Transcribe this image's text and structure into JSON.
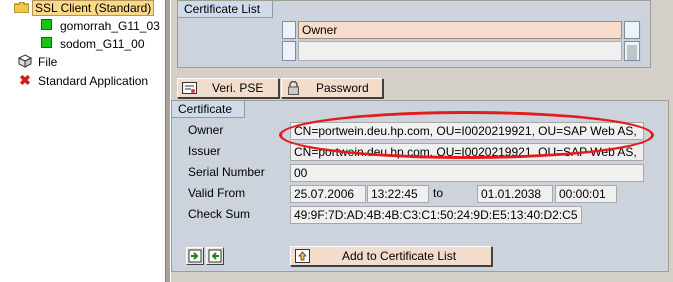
{
  "tree": {
    "root_label": "SSL Client (Standard)",
    "children": [
      "gomorrah_G11_03",
      "sodom_G11_00"
    ],
    "file_label": "File",
    "standard_app_label": "Standard Application"
  },
  "cert_list": {
    "title": "Certificate List",
    "column_header": "Owner",
    "rows": [
      ""
    ]
  },
  "buttons": {
    "veri_pse": "Veri. PSE",
    "password": "Password",
    "add_to_list": "Add to Certificate List"
  },
  "certificate": {
    "title": "Certificate",
    "owner_label": "Owner",
    "owner_value": "CN=portwein.deu.hp.com, OU=I0020219921, OU=SAP Web AS,",
    "issuer_label": "Issuer",
    "issuer_value": "CN=portwein.deu.hp.com, OU=I0020219921, OU=SAP Web AS,",
    "serial_label": "Serial Number",
    "serial_value": "00",
    "valid_from_label": "Valid From",
    "valid_from_date": "25.07.2006",
    "valid_from_time": "13:22:45",
    "to_label": "to",
    "valid_to_date": "01.01.2038",
    "valid_to_time": "00:00:01",
    "checksum_label": "Check Sum",
    "checksum_value": "49:9F:7D:AD:4B:4B:C3:C1:50:24:9D:E5:13:40:D2:C5"
  },
  "colors": {
    "highlight_oval": "#e21c1c",
    "selected_node": "#fbd988",
    "button_face": "#f2dccc",
    "group_background": "#ccd3dc"
  },
  "icons": {
    "root": "folder-icon",
    "child": "green-square-icon",
    "file": "file-icon",
    "standard_app": "red-x-icon",
    "veri_pse": "certificate-icon",
    "password": "lock-icon",
    "add": "import-icon"
  }
}
